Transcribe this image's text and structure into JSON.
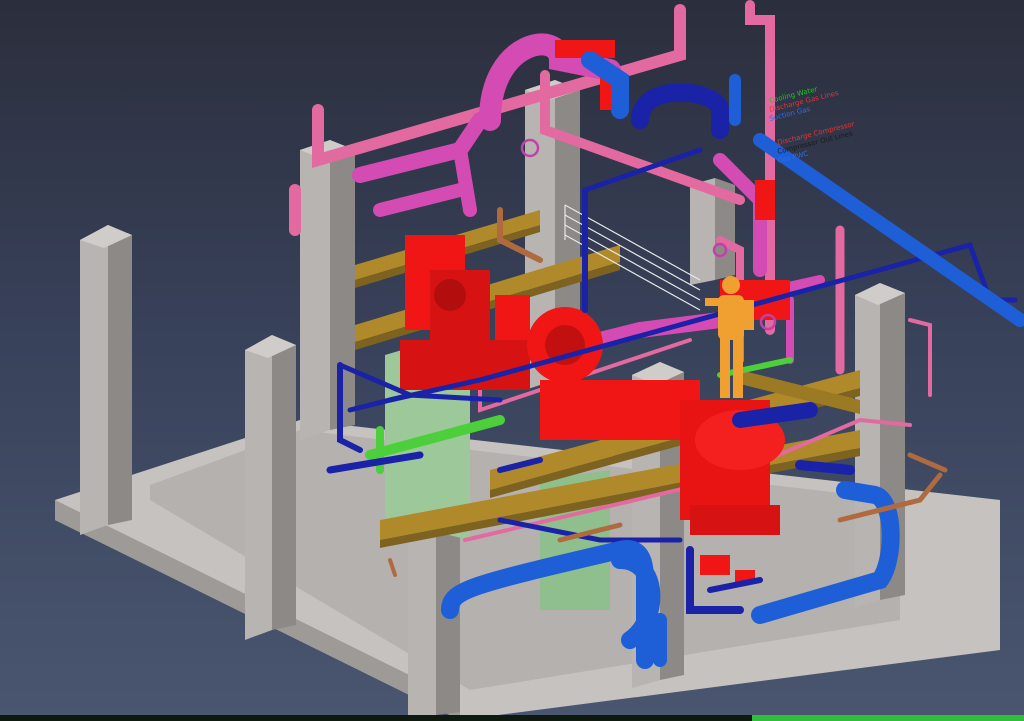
{
  "viewport": {
    "background_top": "#2b2e3c",
    "background_bottom": "#4a5670"
  },
  "legend": {
    "items": [
      {
        "label": "Cooling Water",
        "color": "#22c02a"
      },
      {
        "label": "Discharge Gas Lines",
        "color": "#e03535"
      },
      {
        "label": "Suction Gas",
        "color": "#2f6de8"
      },
      {
        "label": "Discharge Compressor",
        "color": "#e03535"
      },
      {
        "label": "Compressor Out Lines",
        "color": "#1a1a1a"
      },
      {
        "label": "Gas PWC",
        "color": "#2f6de8"
      }
    ]
  },
  "colors": {
    "concrete": "#b8b4b2",
    "concrete_dark": "#8d8987",
    "pink_pipe": "#e36aa0",
    "magenta_pipe": "#d44bb4",
    "blue_pipe": "#1e5fd8",
    "navy_pipe": "#1a22a8",
    "equipment_red": "#f01616",
    "steel_beam": "#b08a2a",
    "green_pipe": "#4ccf3a",
    "operator": "#f0a030",
    "rust_pipe": "#b06a40",
    "skid_green": "#9cc89a"
  }
}
